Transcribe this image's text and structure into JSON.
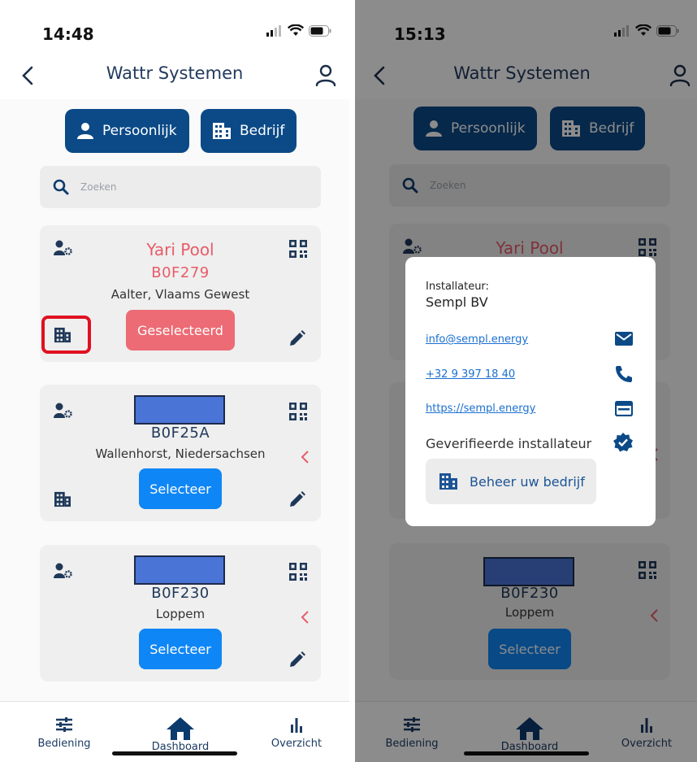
{
  "left": {
    "status": {
      "time": "14:48"
    },
    "header": {
      "title": "Wattr Systemen"
    },
    "segments": {
      "personal_label": "Persoonlijk",
      "business_label": "Bedrijf"
    },
    "search": {
      "placeholder": "Zoeken"
    },
    "cards": [
      {
        "name": "Yari Pool",
        "code": "B0F279",
        "place": "Aalter, Vlaams Gewest",
        "button_label": "Geselecteerd"
      },
      {
        "name": "",
        "code": "B0F25A",
        "place": "Wallenhorst, Niedersachsen",
        "button_label": "Selecteer"
      },
      {
        "name": "",
        "code": "B0F230",
        "place": "Loppem",
        "button_label": "Selecteer"
      }
    ],
    "nav": [
      {
        "label": "Bediening",
        "icon": "sliders-icon"
      },
      {
        "label": "Dashboard",
        "icon": "home-icon"
      },
      {
        "label": "Overzicht",
        "icon": "bar-chart-icon"
      }
    ]
  },
  "right": {
    "status": {
      "time": "15:13"
    },
    "header": {
      "title": "Wattr Systemen"
    },
    "segments": {
      "personal_label": "Persoonlijk",
      "business_label": "Bedrijf"
    },
    "search": {
      "placeholder": "Zoeken"
    },
    "cards": [
      {
        "name": "Yari Pool"
      },
      {
        "code": "B0F230",
        "place": "Loppem",
        "button_label": "Selecteer"
      }
    ],
    "dialog": {
      "label": "Installateur:",
      "company": "Sempl BV",
      "email": "info@sempl.energy",
      "phone": "+32 9 397 18 40",
      "website": "https://sempl.energy",
      "verified_label": "Geverifieerde installateur",
      "manage_label": "Beheer uw bedrijf"
    },
    "nav": [
      {
        "label": "Bediening",
        "icon": "sliders-icon"
      },
      {
        "label": "Dashboard",
        "icon": "home-icon"
      },
      {
        "label": "Overzicht",
        "icon": "bar-chart-icon"
      }
    ]
  },
  "colors": {
    "primary": "#0b4a87",
    "selected": "#ec6b74",
    "select": "#0f86f5",
    "highlight": "#e01020",
    "link": "#1a6fd1"
  }
}
